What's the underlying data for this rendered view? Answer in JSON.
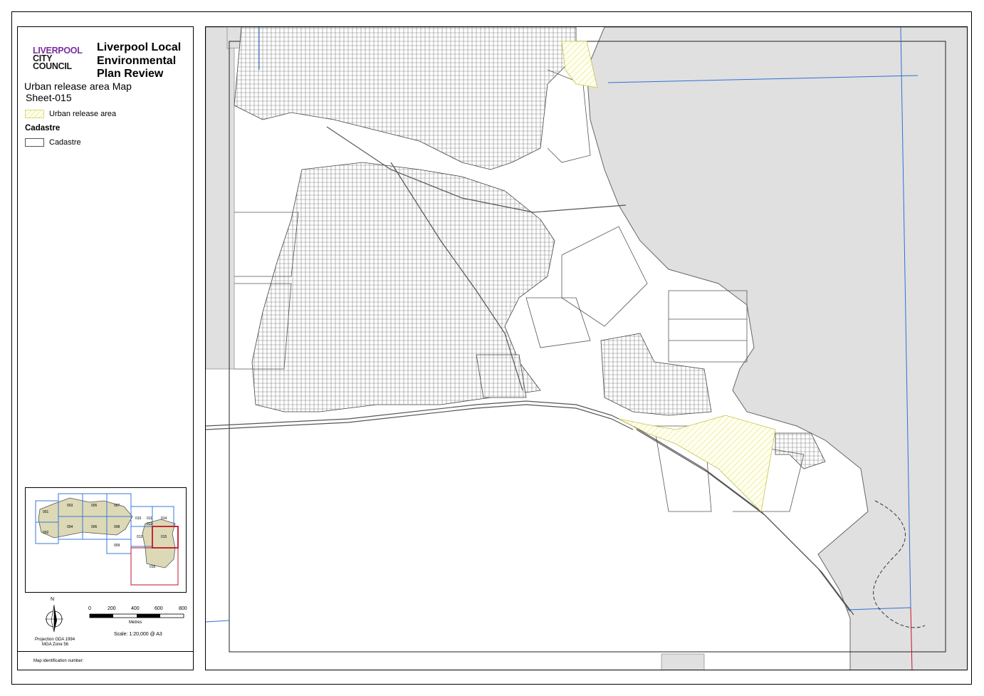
{
  "logo": {
    "line1": "LIVERPOOL",
    "line2": "CITY",
    "line3": "COUNCIL"
  },
  "title": "Liverpool Local Environmental Plan Review",
  "map_title": "Urban release area Map",
  "sheet": "Sheet-015",
  "legend": {
    "items": [
      {
        "label": "Urban release area",
        "symbol": "yellow-hatch-swatch"
      },
      {
        "label": "Cadastre",
        "symbol": "white-box-swatch"
      }
    ],
    "group_heading": "Cadastre"
  },
  "key_map": {
    "sheets": [
      "001",
      "002",
      "003",
      "004",
      "005",
      "006",
      "007",
      "008",
      "009",
      "010",
      "011",
      "012",
      "013",
      "014",
      "015",
      "016"
    ],
    "highlight": "015",
    "colors": {
      "grid": "#3a78d6",
      "highlight": "#c0142a",
      "land": "#ddd9b6"
    }
  },
  "north_label": "N",
  "projection": "Projection GDA 1994",
  "zone": "MGA Zone 56",
  "scale": {
    "ticks": [
      "0",
      "200",
      "400",
      "600",
      "800"
    ],
    "unit": "Metres",
    "text": "Scale: 1:20,000 @ A3"
  },
  "map_id_label": "Map identification number:",
  "colors": {
    "outside_area": "#e0e0e0",
    "urban_release": "#f4f098",
    "boundary_line": "#2f6fd6",
    "red_line": "#c0142a"
  }
}
